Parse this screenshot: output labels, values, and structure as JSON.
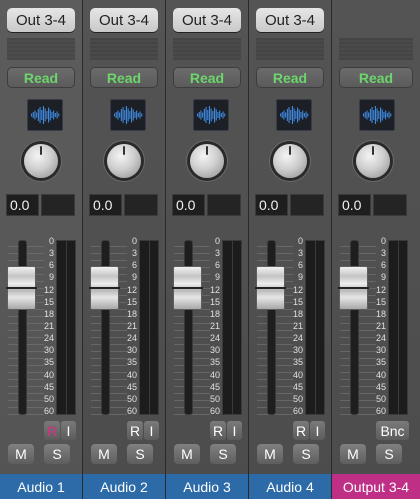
{
  "strips": [
    {
      "output": "Out 3-4",
      "automation": "Read",
      "volume": "0.0",
      "rec_label": "R",
      "input_label": "I",
      "mute": "M",
      "solo": "S",
      "name": "Audio 1"
    },
    {
      "output": "Out 3-4",
      "automation": "Read",
      "volume": "0.0",
      "rec_label": "R",
      "input_label": "I",
      "mute": "M",
      "solo": "S",
      "name": "Audio 2"
    },
    {
      "output": "Out 3-4",
      "automation": "Read",
      "volume": "0.0",
      "rec_label": "R",
      "input_label": "I",
      "mute": "M",
      "solo": "S",
      "name": "Audio 3"
    },
    {
      "output": "Out 3-4",
      "automation": "Read",
      "volume": "0.0",
      "rec_label": "R",
      "input_label": "I",
      "mute": "M",
      "solo": "S",
      "name": "Audio 4"
    },
    {
      "automation": "Read",
      "volume": "0.0",
      "bounce_label": "Bnc",
      "mute": "M",
      "solo": "S",
      "name": "Output 3-4"
    }
  ],
  "fader_scale": [
    "0",
    "3",
    "6",
    "9",
    "12",
    "15",
    "18",
    "21",
    "24",
    "30",
    "35",
    "40",
    "45",
    "50",
    "60"
  ],
  "colors": {
    "audio_track": "#2c6aa8",
    "output_track": "#bf2f86",
    "read_text": "#6cd66c",
    "record_armed": "#b8407a",
    "waveform": "#3f8ae0"
  },
  "icons": {
    "waveform": "audio-waveform-icon",
    "pan": "pan-knob"
  }
}
